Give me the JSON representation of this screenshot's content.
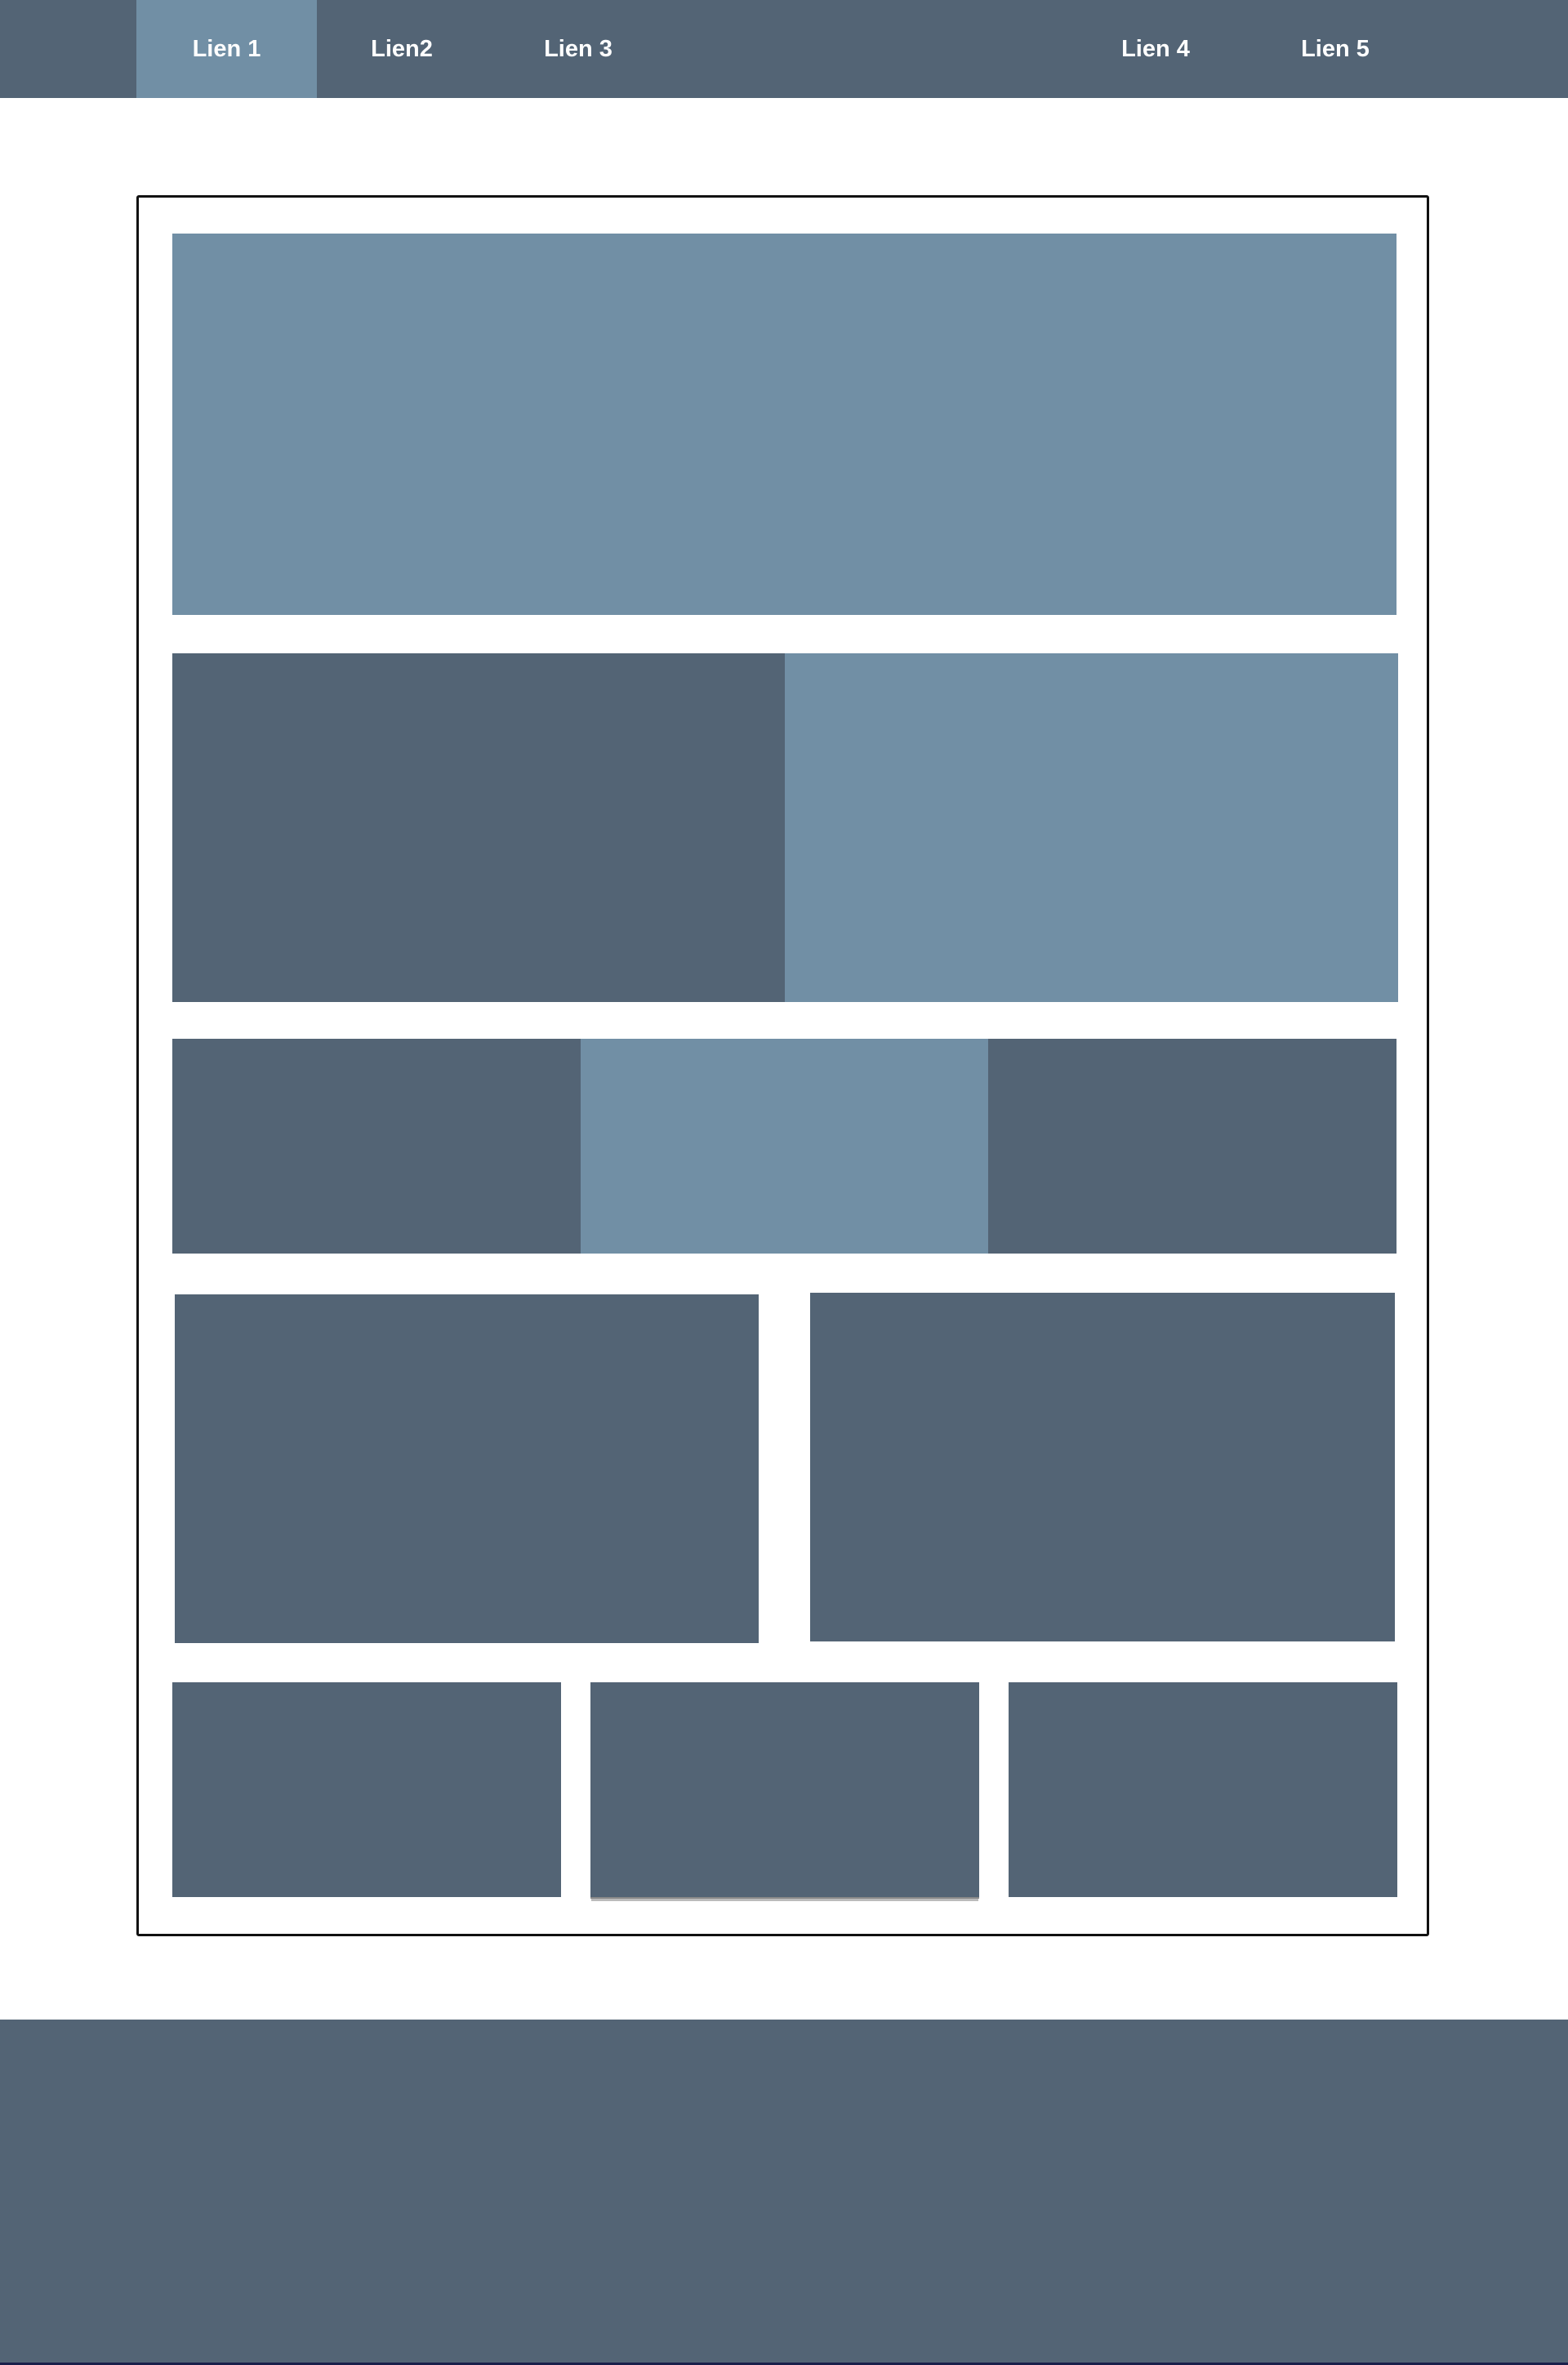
{
  "nav": {
    "links": [
      {
        "label": "Lien 1",
        "active": true
      },
      {
        "label": "Lien2",
        "active": false
      },
      {
        "label": "Lien 3",
        "active": false
      },
      {
        "label": "Lien 4",
        "active": false
      },
      {
        "label": "Lien 5",
        "active": false
      }
    ]
  },
  "colors": {
    "dark_block": "#536475",
    "light_block": "#718fa5",
    "frame_border": "#111111",
    "page_background": "#ffffff",
    "nav_text": "#ffffff"
  }
}
